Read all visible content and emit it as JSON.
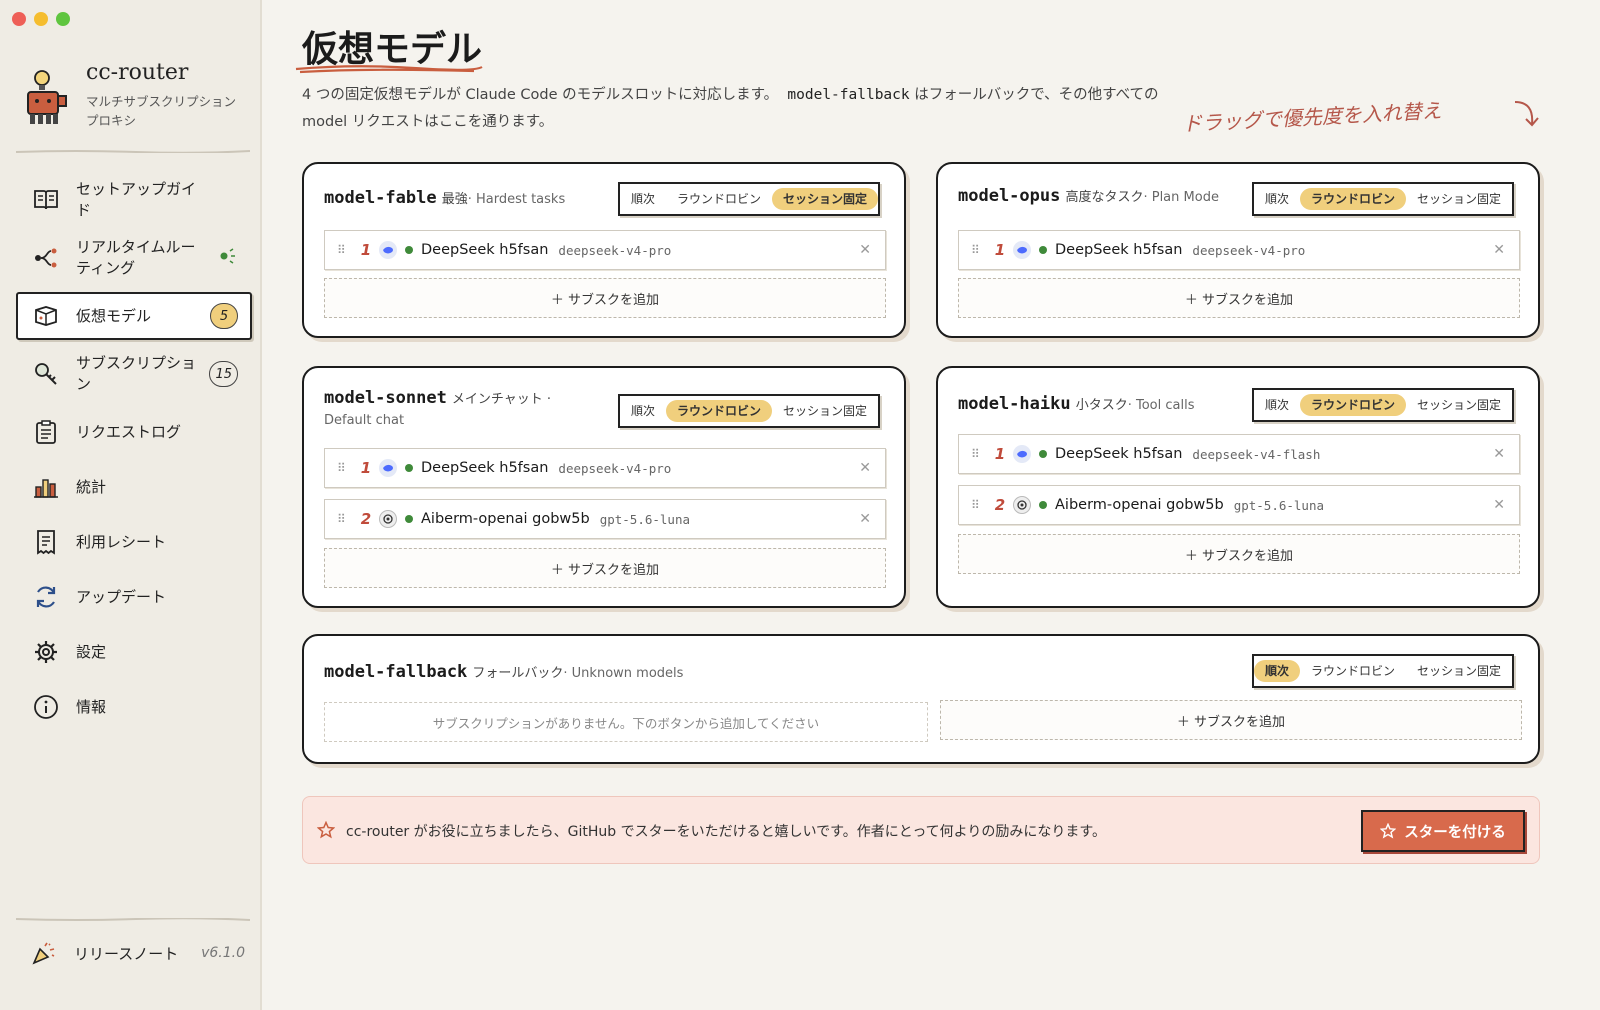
{
  "sidebar": {
    "brand_title": "cc-router",
    "brand_subtitle": "マルチサブスクリプションプロキシ",
    "items": [
      {
        "label": "セットアップガイド",
        "icon": "book-icon"
      },
      {
        "label": "リアルタイムルーティング",
        "icon": "route-icon"
      },
      {
        "label": "仮想モデル",
        "icon": "model-icon",
        "badge": "5"
      },
      {
        "label": "サブスクリプション",
        "icon": "key-icon",
        "badge": "15"
      },
      {
        "label": "リクエストログ",
        "icon": "clipboard-icon"
      },
      {
        "label": "統計",
        "icon": "bar-chart-icon"
      },
      {
        "label": "利用レシート",
        "icon": "receipt-icon"
      },
      {
        "label": "アップデート",
        "icon": "refresh-icon"
      },
      {
        "label": "設定",
        "icon": "gear-icon"
      },
      {
        "label": "情報",
        "icon": "info-icon"
      }
    ],
    "release_label": "リリースノート",
    "version": "v6.1.0"
  },
  "main": {
    "title": "仮想モデル",
    "desc_part1": "4 つの固定仮想モデルが Claude Code のモデルスロットに対応します。",
    "desc_code": "model-fallback",
    "desc_part2": "はフォールバックで、その他すべての model リクエストはここを通ります。",
    "drag_hint": "ドラッグで優先度を入れ替え"
  },
  "strategy_options": [
    "順次",
    "ラウンドロビン",
    "セッション固定"
  ],
  "add_label": "＋ サブスクを追加",
  "empty_label": "サブスクリプションがありません。下のボタンから追加してください",
  "cards": {
    "fable": {
      "name": "model-fable",
      "desc": "最強",
      "desc_en": "· Hardest tasks",
      "strategy": "セッション固定",
      "subs": [
        {
          "prio": "1",
          "provider": "deepseek",
          "account": "DeepSeek h5fsan",
          "model": "deepseek-v4-pro"
        }
      ]
    },
    "opus": {
      "name": "model-opus",
      "desc": "高度なタスク",
      "desc_en": "· Plan Mode",
      "strategy": "ラウンドロビン",
      "subs": [
        {
          "prio": "1",
          "provider": "deepseek",
          "account": "DeepSeek h5fsan",
          "model": "deepseek-v4-pro"
        }
      ]
    },
    "sonnet": {
      "name": "model-sonnet",
      "desc": "メインチャット ·",
      "desc_en": "Default chat",
      "strategy": "ラウンドロビン",
      "subs": [
        {
          "prio": "1",
          "provider": "deepseek",
          "account": "DeepSeek h5fsan",
          "model": "deepseek-v4-pro"
        },
        {
          "prio": "2",
          "provider": "openai",
          "account": "Aiberm-openai gobw5b",
          "model": "gpt-5.6-luna"
        }
      ]
    },
    "haiku": {
      "name": "model-haiku",
      "desc": "小タスク",
      "desc_en": "· Tool calls",
      "strategy": "ラウンドロビン",
      "subs": [
        {
          "prio": "1",
          "provider": "deepseek",
          "account": "DeepSeek h5fsan",
          "model": "deepseek-v4-flash"
        },
        {
          "prio": "2",
          "provider": "openai",
          "account": "Aiberm-openai gobw5b",
          "model": "gpt-5.6-luna"
        }
      ]
    },
    "fallback": {
      "name": "model-fallback",
      "desc": "フォールバック",
      "desc_en": "· Unknown models",
      "strategy": "順次",
      "subs": []
    }
  },
  "banner": {
    "text": "cc-router がお役に立ちましたら、GitHub でスターをいただけると嬉しいです。作者にとって何よりの励みになります。",
    "button": "スターを付ける"
  },
  "colors": {
    "accent": "#f0cf7d",
    "star_button": "#d86a4c",
    "banner_bg": "#fbe6e0",
    "status_ok": "#3f8a3a"
  }
}
